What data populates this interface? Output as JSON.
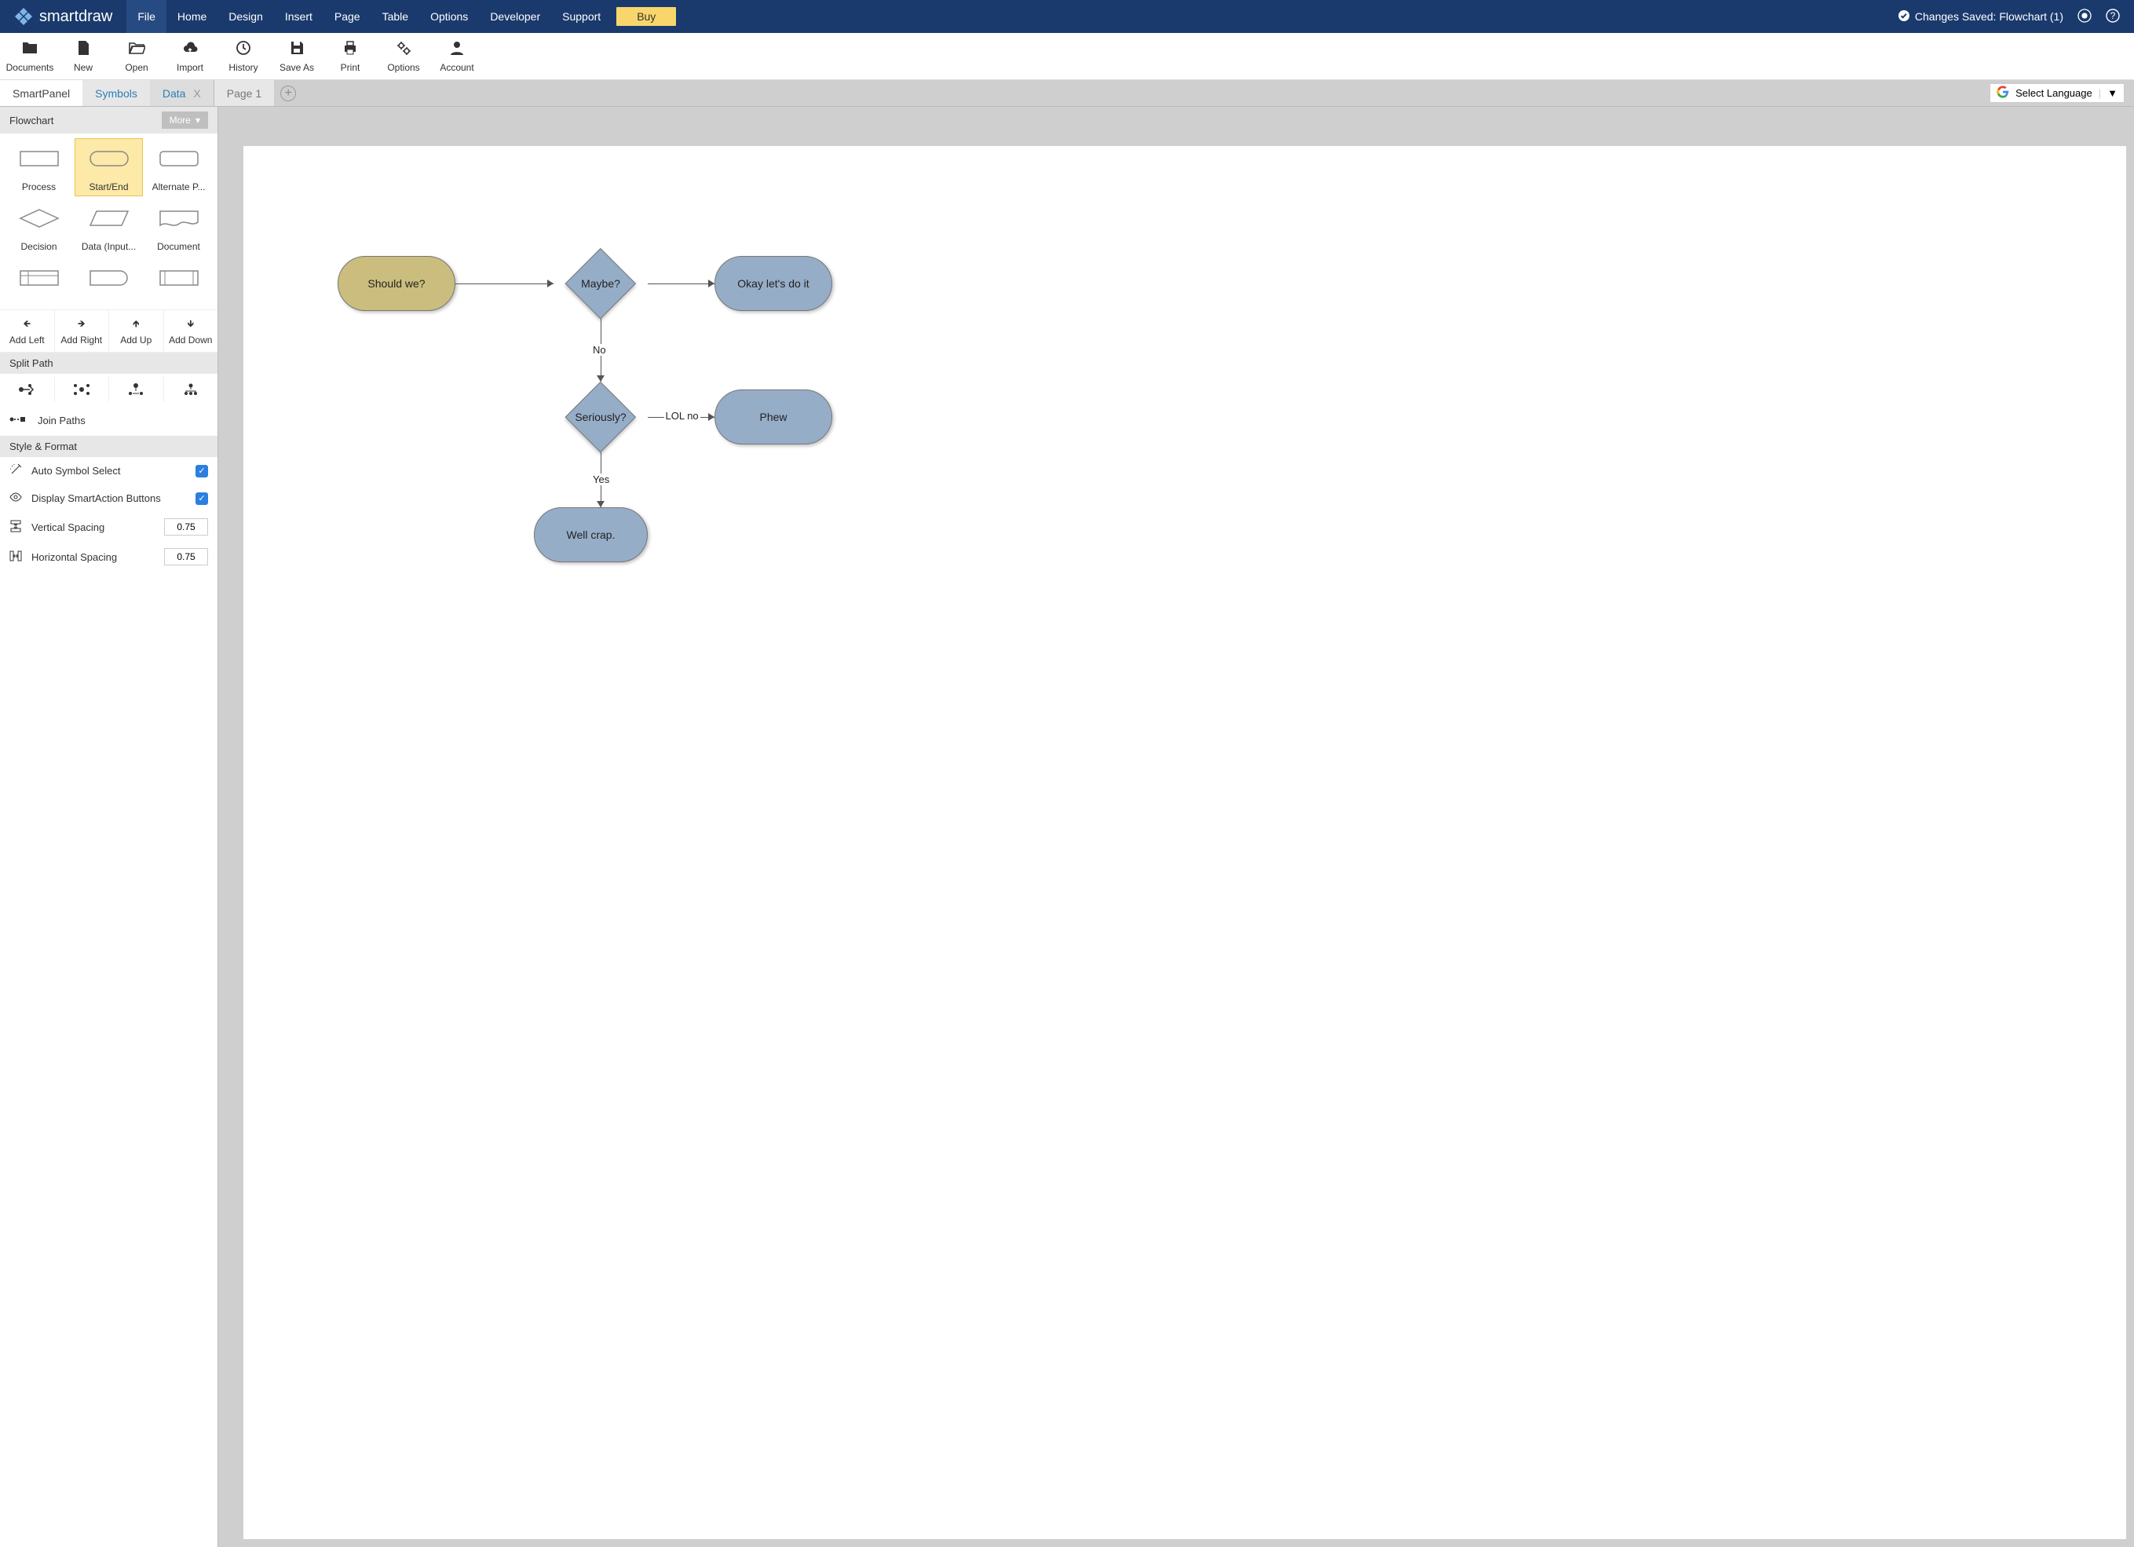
{
  "brand": {
    "name": "smartdraw"
  },
  "menu": {
    "items": [
      "File",
      "Home",
      "Design",
      "Insert",
      "Page",
      "Table",
      "Options",
      "Developer",
      "Support"
    ],
    "active": "File",
    "buy": "Buy"
  },
  "status": {
    "text": "Changes Saved: Flowchart (1)"
  },
  "toolbar": [
    {
      "key": "documents",
      "label": "Documents",
      "icon": "folder"
    },
    {
      "key": "new",
      "label": "New",
      "icon": "file"
    },
    {
      "key": "open",
      "label": "Open",
      "icon": "open-folder"
    },
    {
      "key": "import",
      "label": "Import",
      "icon": "cloud-up"
    },
    {
      "key": "history",
      "label": "History",
      "icon": "clock"
    },
    {
      "key": "saveas",
      "label": "Save As",
      "icon": "save"
    },
    {
      "key": "print",
      "label": "Print",
      "icon": "printer"
    },
    {
      "key": "options",
      "label": "Options",
      "icon": "gears"
    },
    {
      "key": "account",
      "label": "Account",
      "icon": "user"
    }
  ],
  "tabs": {
    "smartpanel": "SmartPanel",
    "symbols": "Symbols",
    "data": "Data",
    "page": "Page 1",
    "language": "Select Language"
  },
  "panel": {
    "flowchart_header": "Flowchart",
    "more": "More",
    "shapes": [
      {
        "key": "process",
        "label": "Process"
      },
      {
        "key": "startend",
        "label": "Start/End",
        "selected": true
      },
      {
        "key": "altprocess",
        "label": "Alternate P..."
      },
      {
        "key": "decision",
        "label": "Decision"
      },
      {
        "key": "data",
        "label": "Data (Input..."
      },
      {
        "key": "document",
        "label": "Document"
      },
      {
        "key": "internal",
        "label": ""
      },
      {
        "key": "delay",
        "label": ""
      },
      {
        "key": "predef",
        "label": ""
      }
    ],
    "add": {
      "left": "Add Left",
      "right": "Add Right",
      "up": "Add Up",
      "down": "Add Down"
    },
    "split_header": "Split Path",
    "join_paths": "Join Paths",
    "style_header": "Style & Format",
    "auto_symbol": "Auto Symbol Select",
    "display_buttons": "Display SmartAction Buttons",
    "v_spacing_label": "Vertical Spacing",
    "h_spacing_label": "Horizontal Spacing",
    "v_spacing": "0.75",
    "h_spacing": "0.75"
  },
  "chart_data": {
    "type": "flowchart",
    "nodes": [
      {
        "id": "n1",
        "kind": "terminator",
        "label": "Should we?",
        "start": true
      },
      {
        "id": "n2",
        "kind": "decision",
        "label": "Maybe?"
      },
      {
        "id": "n3",
        "kind": "terminator",
        "label": "Okay let's do it"
      },
      {
        "id": "n4",
        "kind": "decision",
        "label": "Seriously?"
      },
      {
        "id": "n5",
        "kind": "terminator",
        "label": "Phew"
      },
      {
        "id": "n6",
        "kind": "terminator",
        "label": "Well crap."
      }
    ],
    "edges": [
      {
        "from": "n1",
        "to": "n2",
        "label": ""
      },
      {
        "from": "n2",
        "to": "n3",
        "label": ""
      },
      {
        "from": "n2",
        "to": "n4",
        "label": "No"
      },
      {
        "from": "n4",
        "to": "n5",
        "label": "LOL no"
      },
      {
        "from": "n4",
        "to": "n6",
        "label": "Yes"
      }
    ]
  }
}
